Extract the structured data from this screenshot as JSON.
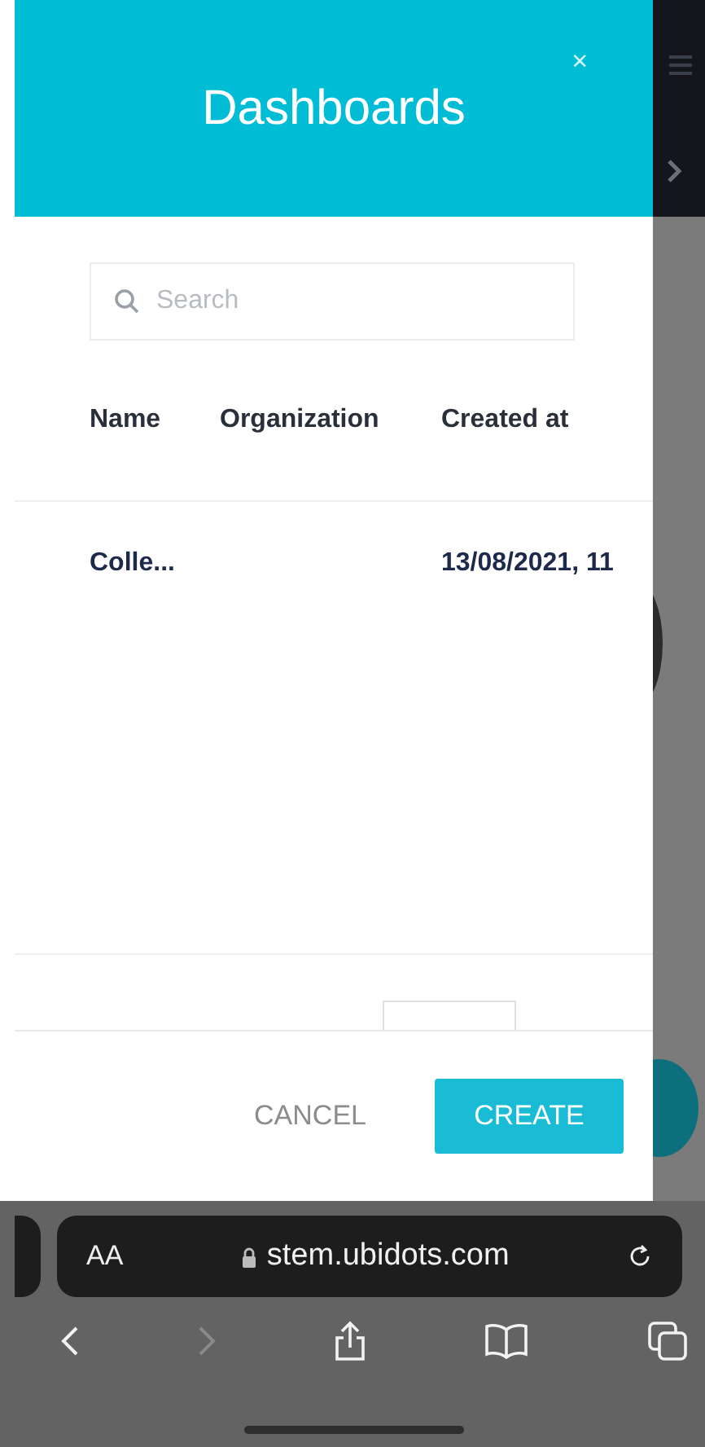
{
  "modal": {
    "title": "Dashboards",
    "close": "×",
    "search": {
      "placeholder": "Search"
    },
    "table": {
      "columns": [
        "Name",
        "Organization",
        "Created at"
      ],
      "rows": [
        [
          "Colle...",
          "",
          "13/08/2021, 11"
        ]
      ]
    },
    "buttons": [
      {
        "label": "CANCEL",
        "kind": "text"
      },
      {
        "label": "CREATE",
        "kind": "primary"
      }
    ]
  },
  "browser": {
    "text_size": "AA",
    "url": "stem.ubidots.com",
    "forward_disabled": true
  }
}
